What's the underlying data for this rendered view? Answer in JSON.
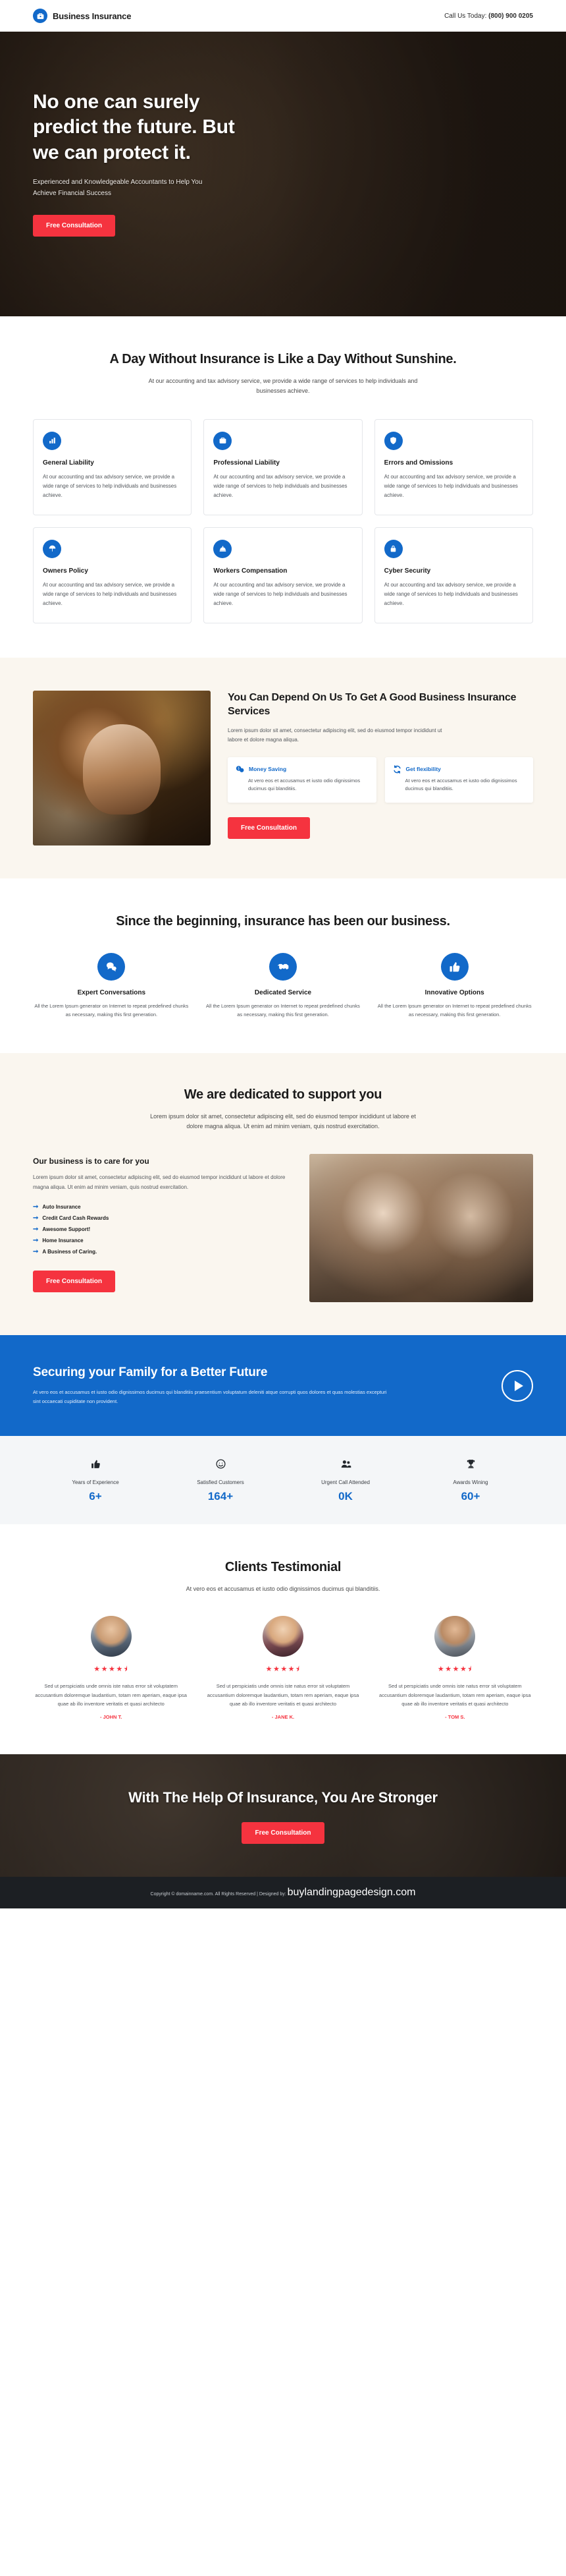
{
  "topbar": {
    "brand_name": "Business Insurance",
    "brand_icon": "briefcase-icon",
    "call_prefix": "Call Us Today: ",
    "phone": "(800) 900 0205"
  },
  "hero": {
    "heading": "No one can surely predict the future. But we can protect it.",
    "subtext": "Experienced and Knowledgeable Accountants to Help You Achieve Financial Success",
    "cta": "Free Consultation"
  },
  "services": {
    "title": "A Day Without Insurance is Like a Day Without Sunshine.",
    "subtitle": "At our accounting and tax advisory service, we provide a wide range of services to help individuals and businesses achieve.",
    "body": "At our accounting and tax advisory service, we provide a wide range of services to help individuals and businesses achieve.",
    "cards": [
      {
        "title": "General Liability",
        "icon": "chart-bar-icon"
      },
      {
        "title": "Professional Liability",
        "icon": "briefcase-icon"
      },
      {
        "title": "Errors and Omissions",
        "icon": "shield-icon"
      },
      {
        "title": "Owners Policy",
        "icon": "umbrella-icon"
      },
      {
        "title": "Workers Compensation",
        "icon": "hardhat-icon"
      },
      {
        "title": "Cyber Security",
        "icon": "lock-icon"
      }
    ]
  },
  "depend": {
    "title": "You Can Depend On Us To Get A Good Business Insurance Services",
    "lead": "Lorem ipsum dolor sit amet, consectetur adipiscing elit, sed do eiusmod tempor incididunt ut labore et dolore magna aliqua.",
    "photo_alt": "woman-reading-photo",
    "cards": [
      {
        "title": "Money Saving",
        "icon": "money-chat-icon",
        "desc": "At vero eos et accusamus et iusto odio dignissimos ducimus qui blanditiis."
      },
      {
        "title": "Get flexibility",
        "icon": "refresh-icon",
        "desc": "At vero eos et accusamus et iusto odio dignissimos ducimus qui blanditiis."
      }
    ],
    "cta": "Free Consultation"
  },
  "since": {
    "title": "Since the beginning, insurance has been our business.",
    "features": [
      {
        "title": "Expert Conversations",
        "icon": "chat-bubble-icon",
        "desc": "All the Lorem Ipsum generator on Internet to repeat predefined chunks as necessary, making this first generation."
      },
      {
        "title": "Dedicated Service",
        "icon": "handshake-icon",
        "desc": "All the Lorem Ipsum generator on Internet to repeat predefined chunks as necessary, making this first generation."
      },
      {
        "title": "Innovative Options",
        "icon": "thumbs-up-icon",
        "desc": "All the Lorem Ipsum generator on Internet to repeat predefined chunks as necessary, making this first generation."
      }
    ]
  },
  "support": {
    "title": "We are dedicated to support you",
    "subtitle": "Lorem ipsum dolor sit amet, consectetur adipiscing elit, sed do eiusmod tempor incididunt ut labore et dolore magna aliqua. Ut enim ad minim veniam, quis nostrud exercitation.",
    "sub_title": "Our business is to care for you",
    "body": "Lorem ipsum dolor sit amet, consectetur adipiscing elit, sed do eiusmod tempor incididunt ut labore et dolore magna aliqua. Ut enim ad minim veniam, quis nostrud exercitation.",
    "bullets": [
      "Auto Insurance",
      "Credit Card Cash Rewards",
      "Awesome Support!",
      "Home Insurance",
      "A Business of Caring."
    ],
    "cta": "Free Consultation",
    "photo_alt": "cafe-staff-photo"
  },
  "bluecta": {
    "title": "Securing your Family for a Better Future",
    "text": "At vero eos et accusamus et iusto odio dignissimos ducimus qui blanditiis praesentium voluptatum deleniti atque corrupti quos dolores et quas molestias excepturi sint occaecati cupiditate non provident.",
    "play_icon": "play-icon"
  },
  "stats": [
    {
      "icon": "thumbs-up-icon",
      "label": "Years of Experience",
      "value": "6+"
    },
    {
      "icon": "smile-icon",
      "label": "Satisfied Customers",
      "value": "164+"
    },
    {
      "icon": "users-icon",
      "label": "Urgent Call Attended",
      "value": "0K"
    },
    {
      "icon": "trophy-icon",
      "label": "Awards Wining",
      "value": "60+"
    }
  ],
  "testimonials": {
    "title": "Clients Testimonial",
    "subtitle": "At vero eos et accusamus et iusto odio dignissimos ducimus qui blanditiis.",
    "stars": "★★★★⯨",
    "items": [
      {
        "avatar": "avatar-man-suit",
        "text": "Sed ut perspiciatis unde omnis iste natus error sit voluptatem accusantium doloremque laudantium, totam rem aperiam, eaque ipsa quae ab illo inventore veritatis et quasi architecto",
        "name": "- JOHN T."
      },
      {
        "avatar": "avatar-woman",
        "text": "Sed ut perspiciatis unde omnis iste natus error sit voluptatem accusantium doloremque laudantium, totam rem aperiam, eaque ipsa quae ab illo inventore veritatis et quasi architecto",
        "name": "- JANE K."
      },
      {
        "avatar": "avatar-man-casual",
        "text": "Sed ut perspiciatis unde omnis iste natus error sit voluptatem accusantium doloremque laudantium, totam rem aperiam, eaque ipsa quae ab illo inventore veritatis et quasi architecto",
        "name": "- TOM S."
      }
    ]
  },
  "bottomcta": {
    "title": "With The Help Of Insurance, You Are Stronger",
    "cta": "Free Consultation"
  },
  "footer": {
    "text": "Copyright © domainname.com. All Rights Reserved | Designed by: ",
    "link": "buylandingpagedesign.com"
  },
  "colors": {
    "brand_blue": "#1269c9",
    "accent_red": "#f5333f",
    "cream": "#faf6ef",
    "dark": "#1c1f23"
  }
}
